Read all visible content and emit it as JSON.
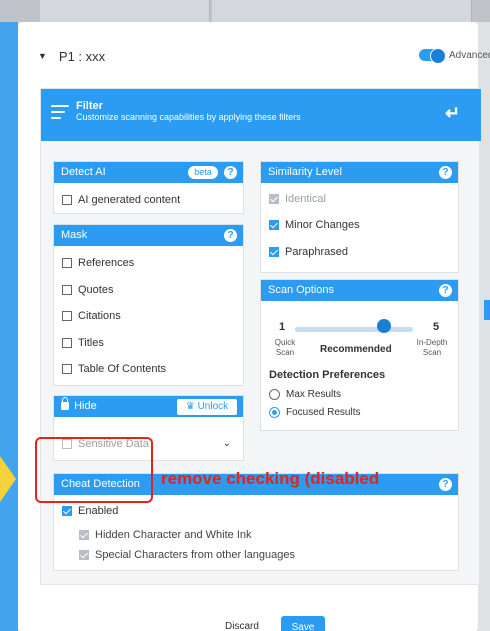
{
  "profile": {
    "name": "P1 : xxx",
    "advanced_label": "Advanced"
  },
  "filter": {
    "title": "Filter",
    "subtitle": "Customize scanning capabilities by applying these filters"
  },
  "detect_ai": {
    "title": "Detect AI",
    "badge": "beta",
    "items": [
      {
        "label": "AI generated content",
        "checked": false
      }
    ]
  },
  "mask": {
    "title": "Mask",
    "items": [
      {
        "label": "References",
        "checked": false
      },
      {
        "label": "Quotes",
        "checked": false
      },
      {
        "label": "Citations",
        "checked": false
      },
      {
        "label": "Titles",
        "checked": false
      },
      {
        "label": "Table Of Contents",
        "checked": false
      }
    ]
  },
  "hide": {
    "title": "Hide",
    "unlock_label": "Unlock",
    "items": [
      {
        "label": "Sensitive Data",
        "checked": false
      }
    ]
  },
  "similarity": {
    "title": "Similarity Level",
    "items": [
      {
        "label": "Identical",
        "checked": true,
        "disabled": true
      },
      {
        "label": "Minor Changes",
        "checked": true
      },
      {
        "label": "Paraphrased",
        "checked": true
      }
    ]
  },
  "scan_options": {
    "title": "Scan Options",
    "min_value": "1",
    "max_value": "5",
    "min_label_line1": "Quick",
    "min_label_line2": "Scan",
    "max_label_line1": "In-Depth",
    "max_label_line2": "Scan",
    "selected_label": "Recommended",
    "slider_value": 4,
    "prefs_title": "Detection Preferences",
    "options": [
      {
        "label": "Max Results",
        "selected": false
      },
      {
        "label": "Focused Results",
        "selected": true
      }
    ]
  },
  "cheat_detection": {
    "title": "Cheat Detection",
    "items": [
      {
        "label": "Enabled",
        "checked": true
      },
      {
        "label": "Hidden Character and White Ink",
        "checked": true,
        "disabled": true
      },
      {
        "label": "Special Characters from other languages",
        "checked": true,
        "disabled": true
      }
    ]
  },
  "annotation": "remove checking (disabled",
  "footer": {
    "discard_label": "Discard",
    "save_label": "Save"
  },
  "colors": {
    "accent": "#2b9cf2",
    "annotation_red": "#e5231b",
    "arrow_yellow": "#f8d23c"
  }
}
